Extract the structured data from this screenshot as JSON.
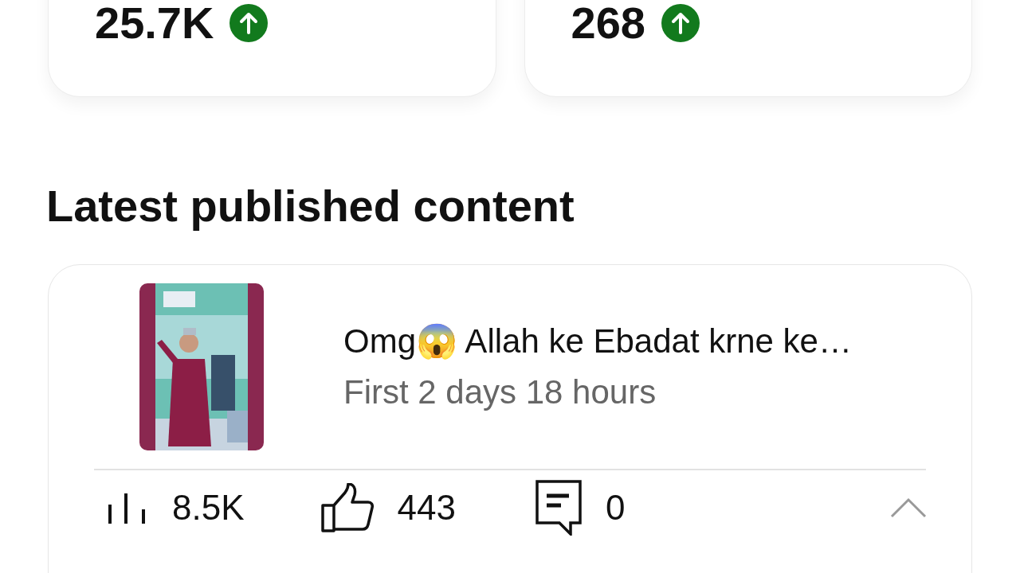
{
  "metric_cards": [
    {
      "value": "25.7K",
      "kind": "up"
    },
    {
      "value": "268",
      "kind": "up"
    }
  ],
  "section_title": "Latest published content",
  "content_card": {
    "title": "Omg😱 Allah ke Ebadat krne ke…",
    "subtitle": "First 2 days 18 hours",
    "stats": [
      {
        "kind": "views",
        "value": "8.5K"
      },
      {
        "kind": "likes",
        "value": "443"
      },
      {
        "kind": "comments",
        "value": "0"
      }
    ],
    "expanded": true
  }
}
